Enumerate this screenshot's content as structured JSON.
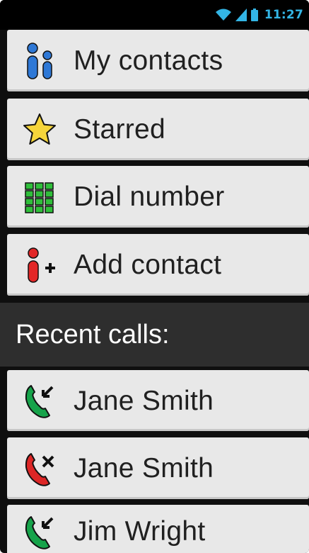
{
  "status_bar": {
    "time": "11:27",
    "icons": [
      "wifi-icon",
      "signal-icon",
      "battery-icon"
    ],
    "accent_color": "#33b5e5"
  },
  "menu": {
    "items": [
      {
        "label": "My contacts",
        "icon": "contacts-icon"
      },
      {
        "label": "Starred",
        "icon": "star-icon"
      },
      {
        "label": "Dial number",
        "icon": "dialpad-icon"
      },
      {
        "label": "Add contact",
        "icon": "add-contact-icon"
      }
    ]
  },
  "recent_calls": {
    "header": "Recent calls:",
    "items": [
      {
        "name": "Jane Smith",
        "icon": "incoming-call-icon",
        "status_color": "#16a34a"
      },
      {
        "name": "Jane Smith",
        "icon": "missed-call-icon",
        "status_color": "#dc2626"
      },
      {
        "name": "Jim Wright",
        "icon": "incoming-call-icon",
        "status_color": "#16a34a"
      }
    ]
  }
}
